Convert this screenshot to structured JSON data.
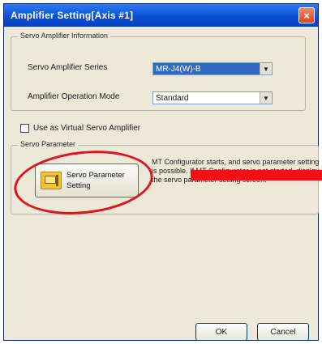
{
  "window": {
    "title": "Amplifier Setting[Axis #1]",
    "close_label": "×"
  },
  "amplifier_info": {
    "legend": "Servo Amplifier Information",
    "series_label": "Servo Amplifier Series",
    "series_value": "MR-J4(W)-B",
    "mode_label": "Amplifier Operation Mode",
    "mode_value": "Standard"
  },
  "virtual_amp": {
    "label": "Use as Virtual Servo Amplifier",
    "checked": false
  },
  "servo_param": {
    "legend": "Servo Parameter",
    "button_line1": "Servo Parameter",
    "button_line2": "Setting",
    "description": "MT Configurator starts, and servo parameter setting is possible. If MT Configurator is not started, display the servo parameter setting screen."
  },
  "footer": {
    "ok_label": "OK",
    "cancel_label": "Cancel"
  },
  "icons": {
    "dropdown": "chevron-down-icon",
    "close": "close-icon",
    "settings": "servo-parameter-icon"
  },
  "colors": {
    "title_bar": "#0a4fd6",
    "annotation": "#e2131a",
    "selection": "#316ac5"
  }
}
